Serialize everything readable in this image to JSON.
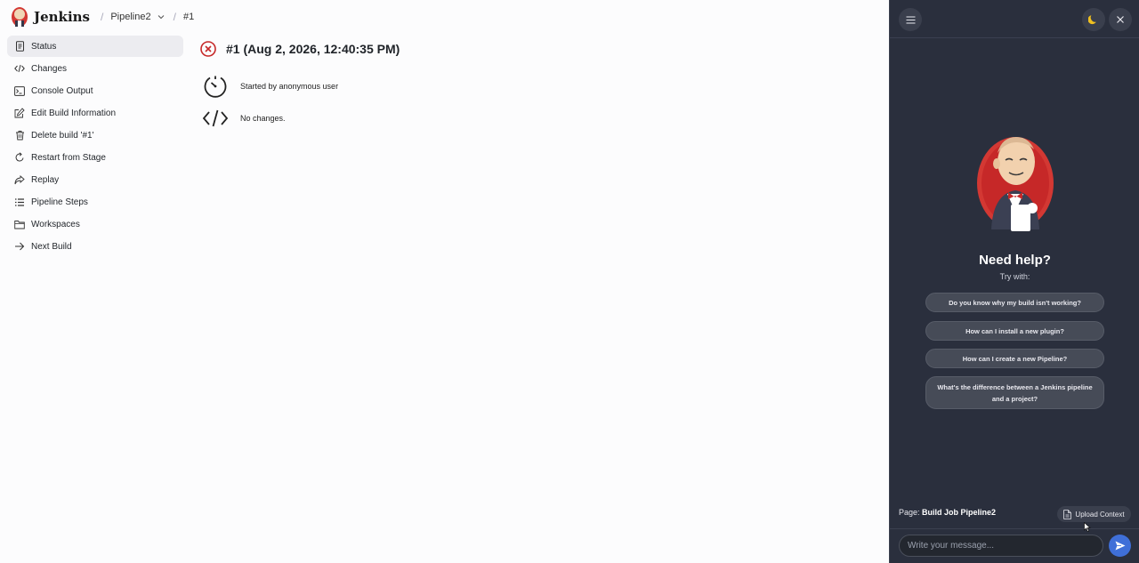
{
  "header": {
    "brand": "Jenkins",
    "breadcrumbs": [
      {
        "label": "Pipeline2"
      },
      {
        "label": "#1"
      }
    ]
  },
  "sidebar": {
    "items": [
      {
        "label": "Status",
        "icon": "document-icon",
        "active": true
      },
      {
        "label": "Changes",
        "icon": "code-icon"
      },
      {
        "label": "Console Output",
        "icon": "terminal-icon"
      },
      {
        "label": "Edit Build Information",
        "icon": "edit-icon"
      },
      {
        "label": "Delete build '#1'",
        "icon": "trash-icon"
      },
      {
        "label": "Restart from Stage",
        "icon": "restart-icon"
      },
      {
        "label": "Replay",
        "icon": "replay-icon"
      },
      {
        "label": "Pipeline Steps",
        "icon": "list-icon"
      },
      {
        "label": "Workspaces",
        "icon": "folder-icon"
      },
      {
        "label": "Next Build",
        "icon": "arrow-right-icon"
      }
    ]
  },
  "main": {
    "title": "#1 (Aug 2, 2026, 12:40:35 PM)",
    "status": "failed",
    "started_by": "Started by anonymous user",
    "changes": "No changes."
  },
  "chat": {
    "heading": "Need help?",
    "subheading": "Try with:",
    "suggestions": [
      "Do you know why my build isn't working?",
      "How can I install a new plugin?",
      "How can I create a new Pipeline?",
      "What's the difference between a Jenkins pipeline and a project?"
    ],
    "page_label": "Page:",
    "page_value": "Build Job Pipeline2",
    "upload_label": "Upload Context",
    "input_placeholder": "Write your message..."
  },
  "colors": {
    "panel_bg": "#2a2f3d",
    "error_red": "#c62828",
    "send_blue": "#3f6fd8",
    "active_item_bg": "#ececf0"
  }
}
